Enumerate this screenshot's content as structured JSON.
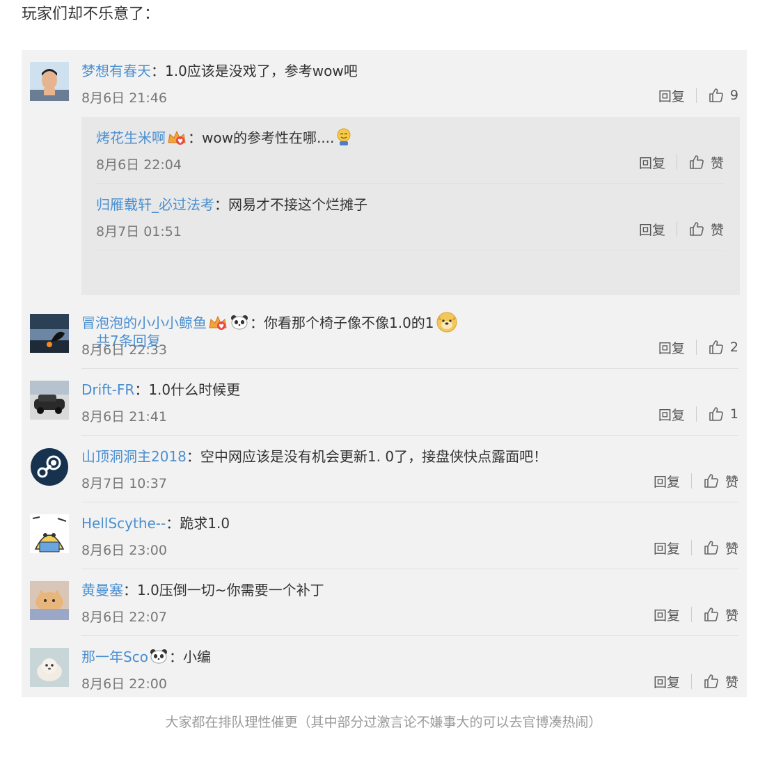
{
  "intro": "玩家们却不乐意了：",
  "caption": "大家都在排队理性催更（其中部分过激言论不嫌事大的可以去官博凑热闹）",
  "reply_label": "回复",
  "like_label": "赞",
  "comments": [
    {
      "user": "梦想有春天",
      "colon": "：",
      "text": "1.0应该是没戏了，参考wow吧",
      "time": "8月6日 21:46",
      "likes": "9",
      "avatar": "person-photo"
    },
    {
      "user": "冒泡泡的小小小鲸鱼",
      "colon": "：",
      "text": "你看那个椅子像不像1.0的1",
      "time": "8月6日 22:33",
      "likes": "2",
      "avatar": "orca-photo"
    },
    {
      "user": "Drift-FR",
      "colon": "：",
      "text": "1.0什么时候更",
      "time": "8月6日 21:41",
      "likes": "1",
      "avatar": "car-photo"
    },
    {
      "user": "山顶洞洞主2018",
      "colon": "：",
      "text": "空中网应该是没有机会更新1. 0了，接盘侠快点露面吧！",
      "time": "8月7日 10:37",
      "likes": "赞",
      "avatar": "steam-logo"
    },
    {
      "user": "HellScythe--",
      "colon": "：",
      "text": "跪求1.0",
      "time": "8月6日 23:00",
      "likes": "赞",
      "avatar": "anime-drawing"
    },
    {
      "user": "黄曼塞",
      "colon": "：",
      "text": "1.0压倒一切~你需要一个补丁",
      "time": "8月6日 22:07",
      "likes": "赞",
      "avatar": "cat-photo"
    },
    {
      "user": "那一年Sco",
      "colon": "：",
      "text": "小编",
      "time": "8月6日 22:00",
      "likes": "赞",
      "avatar": "puppy-photo"
    }
  ],
  "subreplies": [
    {
      "user": "烤花生米啊",
      "colon": "：",
      "text": "wow的参考性在哪....",
      "time": "8月6日 22:04",
      "likes": "赞"
    },
    {
      "user": "归雁载轩_必过法考",
      "colon": "：",
      "text": "网易才不接这个烂摊子",
      "time": "8月7日 01:51",
      "likes": "赞"
    }
  ],
  "more_replies": "共7条回复",
  "colors": {
    "link": "#4a8fd0",
    "panel": "#f2f2f2",
    "subpanel": "#e8e8e8"
  }
}
